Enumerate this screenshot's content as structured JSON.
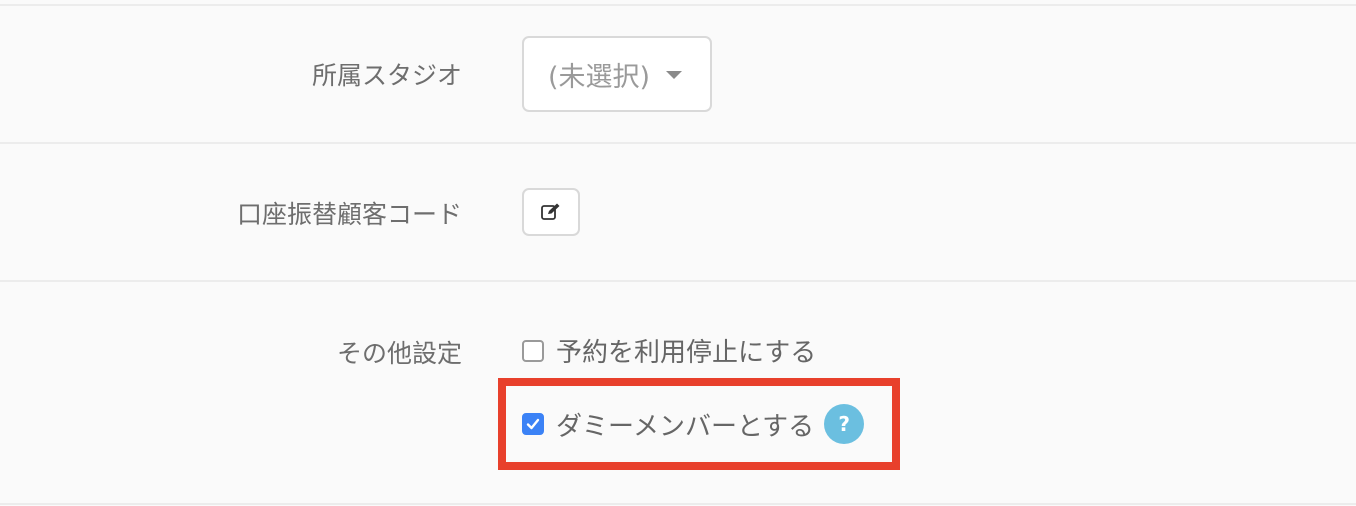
{
  "fields": {
    "studio": {
      "label": "所属スタジオ",
      "selected": "(未選択)"
    },
    "bank_code": {
      "label": "口座振替顧客コード"
    },
    "other": {
      "label": "その他設定",
      "options": [
        {
          "label": "予約を利用停止にする",
          "checked": false
        },
        {
          "label": "ダミーメンバーとする",
          "checked": true
        }
      ],
      "help_glyph": "?"
    }
  },
  "icons": {
    "edit": "pencil-square-icon",
    "caret": "caret-down-icon",
    "help": "question-circle-icon",
    "check": "checkmark-icon"
  },
  "colors": {
    "checkbox_checked": "#3b82f6",
    "help_badge": "#6bbfe0",
    "highlight": "#e8402c"
  }
}
